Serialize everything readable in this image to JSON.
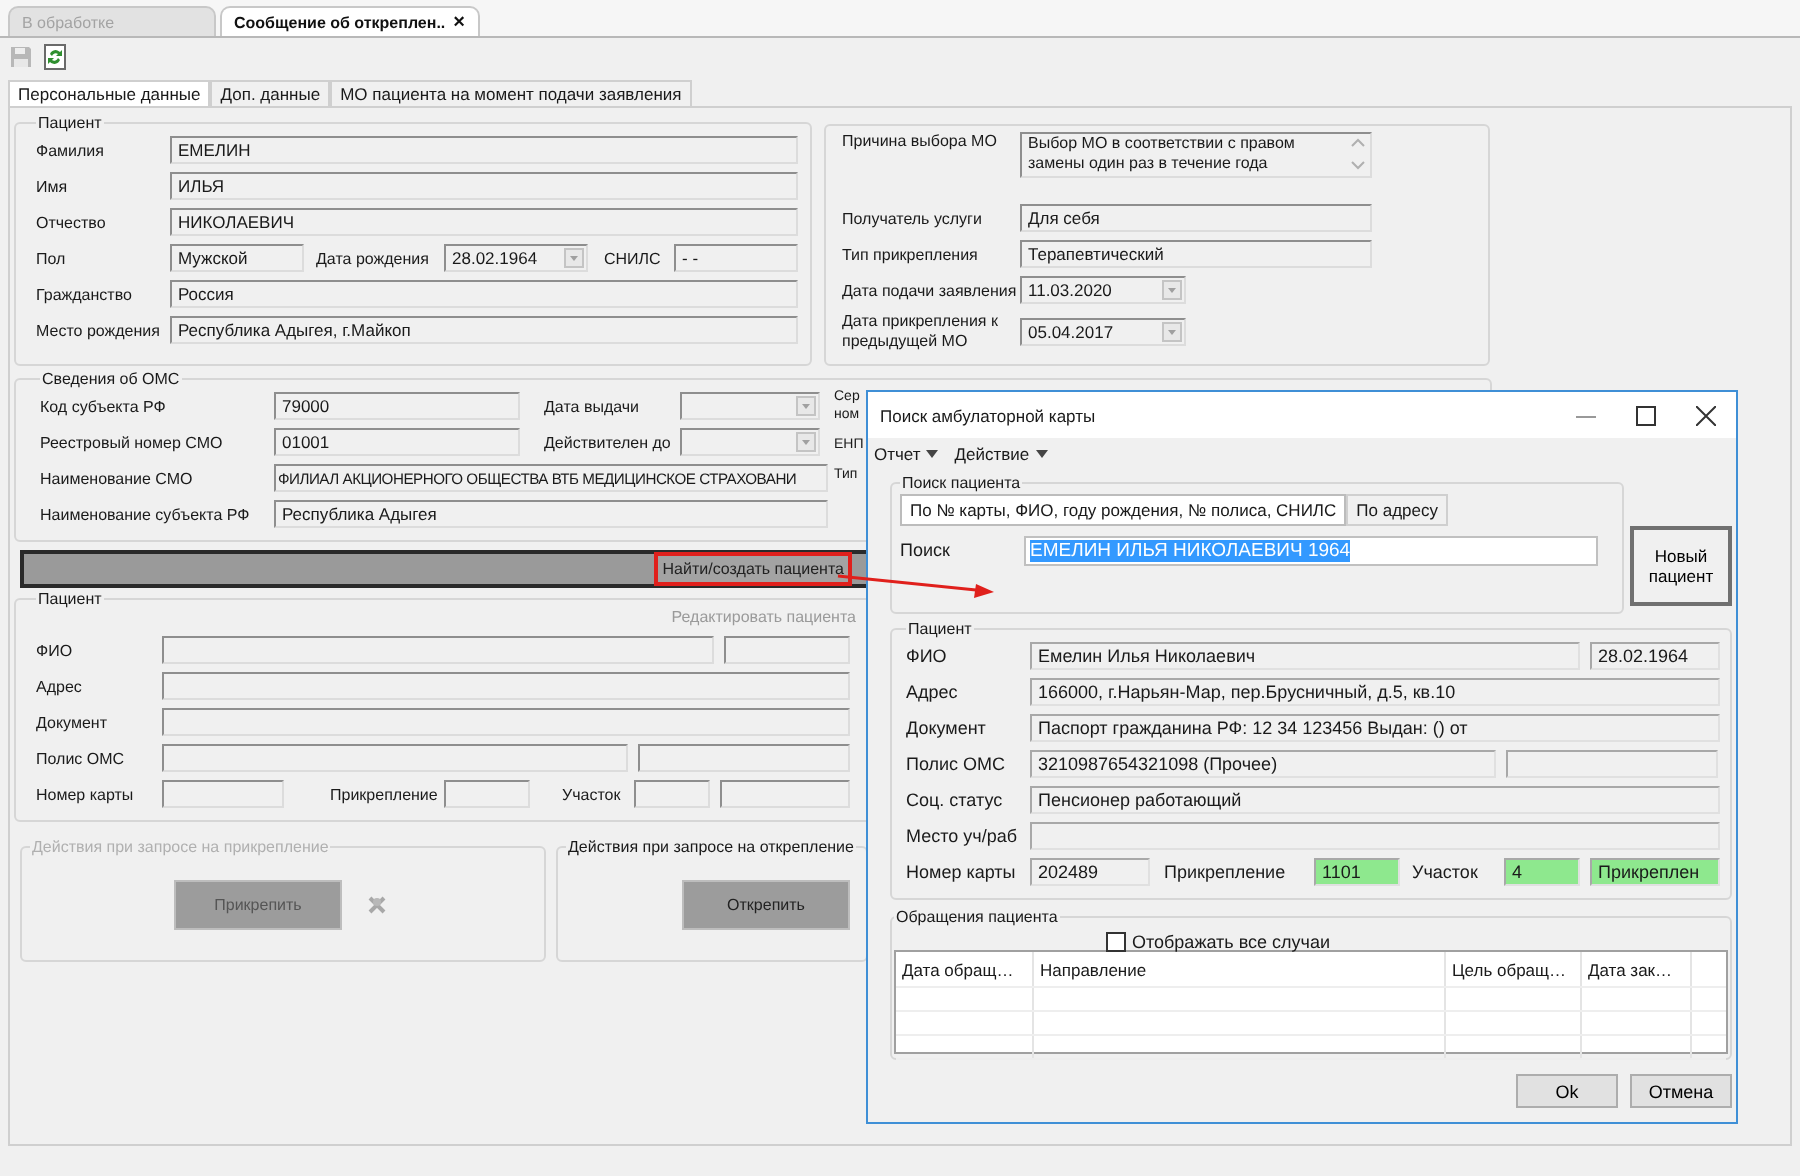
{
  "doc_tabs": [
    {
      "label": "В обработке",
      "selected": false
    },
    {
      "label": "Сообщение об откреплен..",
      "selected": true,
      "close": "×"
    }
  ],
  "toolbar": [
    {
      "kind": "save",
      "disabled": true
    },
    {
      "kind": "refresh",
      "disabled": false
    }
  ],
  "tabs": [
    {
      "label": "Персональные данные",
      "selected": true
    },
    {
      "label": "Доп. данные",
      "selected": false
    },
    {
      "label": "МО пациента на момент подачи заявления",
      "selected": false
    }
  ],
  "patient": {
    "title": "Пациент",
    "surname": {
      "label": "Фамилия",
      "value": "ЕМЕЛИН"
    },
    "name": {
      "label": "Имя",
      "value": "ИЛЬЯ"
    },
    "patronymic": {
      "label": "Отчество",
      "value": "НИКОЛАЕВИЧ"
    },
    "sex": {
      "label": "Пол",
      "value": "Мужской"
    },
    "birth_date": {
      "label": "Дата рождения",
      "value": "28.02.1964"
    },
    "snils": {
      "label": "СНИЛС",
      "value": "-  -"
    },
    "citizenship": {
      "label": "Гражданство",
      "value": "Россия"
    },
    "birthplace": {
      "label": "Место рождения",
      "value": "Республика Адыгея, г.Майкоп"
    }
  },
  "application": {
    "reason": {
      "label": "Причина выбора МО",
      "value": "Выбор МО в соответствии с правом замены один раз в течение года"
    },
    "recipient": {
      "label": "Получатель услуги",
      "value": "Для себя"
    },
    "attachment_type": {
      "label": "Тип прикрепления",
      "value": "Терапевтический"
    },
    "application_date": {
      "label": "Дата подачи заявления",
      "value": "11.03.2020"
    },
    "previous_date": {
      "label": "Дата прикрепления к предыдущей МО",
      "value": "05.04.2017"
    }
  },
  "oms": {
    "title": "Сведения об ОМС",
    "region_code": {
      "label": "Код субъекта РФ",
      "value": "79000"
    },
    "issue_date": {
      "label": "Дата выдачи"
    },
    "registry_number": {
      "label": "Реестровый номер  СМО",
      "value": "01001"
    },
    "valid_until": {
      "label": "Действителен до"
    },
    "smo_name": {
      "label": "Наименование СМО",
      "value": "ФИЛИАЛ АКЦИОНЕРНОГО ОБЩЕСТВА ВТБ МЕДИЦИНСКОЕ СТРАХОВАНИ"
    },
    "region_name": {
      "label": "Наименование субъекта РФ",
      "value": "Республика Адыгея"
    },
    "right_labels": [
      "Сер",
      "ном",
      "ЕНП",
      "Тип"
    ]
  },
  "find_button": {
    "label": "Найти/создать пациента"
  },
  "linked_patient": {
    "title": "Пациент",
    "edit_link": {
      "label": "Редактировать пациента",
      "disabled": true
    },
    "labels": [
      "ФИО",
      "Адрес",
      "Документ",
      "Полис ОМС",
      "Номер карты"
    ],
    "attachment_label": "Прикрепление",
    "district_label": "Участок"
  },
  "attach_actions": {
    "title": "Действия при запросе на прикрепление",
    "disabled": true,
    "button": "Прикрепить"
  },
  "detach_actions": {
    "title": "Действия при запросе на открепление",
    "disabled": false,
    "button": "Открепить"
  },
  "dialog": {
    "title": "Поиск амбулаторной карты",
    "menu": [
      {
        "label": "Отчет"
      },
      {
        "label": "Действие"
      }
    ],
    "search": {
      "title": "Поиск пациента",
      "tabs": [
        {
          "label": "По № карты, ФИО, году рождения, № полиса, СНИЛС",
          "selected": true
        },
        {
          "label": "По адресу",
          "selected": false
        }
      ],
      "label": "Поиск",
      "value": "ЕМЕЛИН ИЛЬЯ НИКОЛАЕВИЧ 1964",
      "value_selected": true
    },
    "new_button": "Новый пациент",
    "patient": {
      "title": "Пациент",
      "fio": {
        "label": "ФИО",
        "value": "Емелин Илья Николаевич",
        "birth_date": "28.02.1964"
      },
      "address": {
        "label": "Адрес",
        "value": "166000, г.Нарьян-Мар, пер.Брусничный, д.5, кв.10"
      },
      "document": {
        "label": "Документ",
        "value": "Паспорт гражданина РФ: 12 34 123456 Выдан: () от"
      },
      "policy": {
        "label": "Полис ОМС",
        "value": "3210987654321098 (Прочее)"
      },
      "social": {
        "label": "Соц. статус",
        "value": "Пенсионер работающий"
      },
      "workplace": {
        "label": "Место уч/раб"
      },
      "card": {
        "label": "Номер карты",
        "value": "202489"
      },
      "attachment": {
        "label": "Прикрепление",
        "value": "1101",
        "highlighted": true
      },
      "district": {
        "label": "Участок",
        "value": "4",
        "highlighted": true
      },
      "status": {
        "value": "Прикреплен",
        "highlighted": true
      }
    },
    "visits": {
      "title": "Обращения пациента",
      "show_all": {
        "label": "Отображать все случаи",
        "checked": false
      },
      "columns": [
        "Дата обращ…",
        "Направление",
        "Цель обращ…",
        "Дата зак…"
      ]
    },
    "buttons": [
      "Ok",
      "Отмена"
    ]
  }
}
